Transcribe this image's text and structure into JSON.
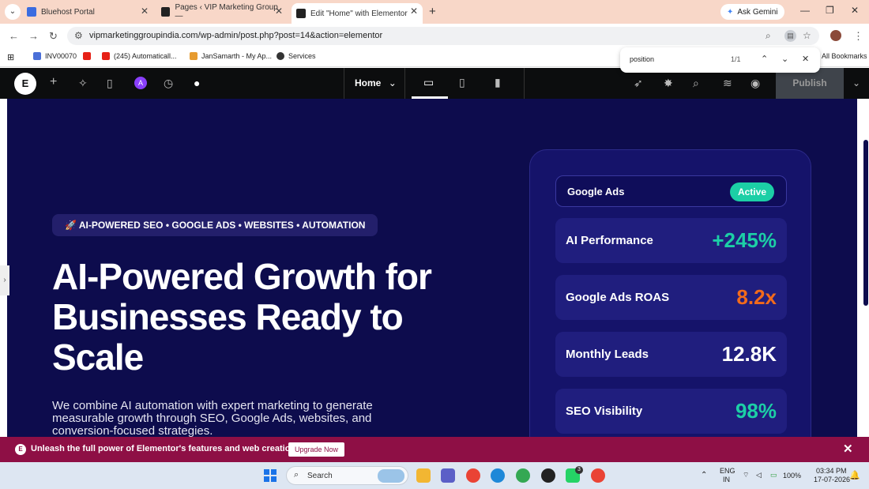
{
  "browser": {
    "tabs": [
      {
        "title": "Bluehost Portal",
        "color": "#3b6ce0"
      },
      {
        "title": "Pages ‹ VIP Marketing Group —",
        "color": "#222222"
      },
      {
        "title": "Edit \"Home\" with Elementor",
        "color": "#222222"
      }
    ],
    "ask_gemini": "Ask Gemini",
    "url": "vipmarketinggroupindia.com/wp-admin/post.php?post=14&action=elementor",
    "bookmarks": [
      {
        "label": "INV00070",
        "color": "#4a6fd8"
      },
      {
        "label": "",
        "color": "#e62117"
      },
      {
        "label": "(245) Automaticall...",
        "color": "#e62117"
      },
      {
        "label": "JanSamarth - My Ap...",
        "color": "#e69b2f"
      },
      {
        "label": "Services",
        "color": "#333333"
      }
    ],
    "all_bookmarks": "All Bookmarks",
    "find": {
      "query": "position",
      "count": "1/1"
    }
  },
  "editor": {
    "page_name": "Home",
    "publish_label": "Publish",
    "logo_letter": "E",
    "ai_letter": "A"
  },
  "hero": {
    "pill": "🚀 AI-POWERED SEO • GOOGLE ADS • WEBSITES • AUTOMATION",
    "title": "AI-Powered Growth for Businesses Ready to Scale",
    "subtitle": "We combine AI automation with expert marketing to generate measurable growth through SEO, Google Ads, websites, and conversion-focused strategies."
  },
  "stats_card": {
    "header_label": "Google Ads",
    "header_badge": "Active",
    "badge_color": "#1ccfa6",
    "stats": [
      {
        "label": "AI Performance",
        "value": "+245%",
        "color": "#1ccfa6"
      },
      {
        "label": "Google Ads ROAS",
        "value": "8.2x",
        "color": "#f26a1b"
      },
      {
        "label": "Monthly Leads",
        "value": "12.8K",
        "color": "#ffffff"
      },
      {
        "label": "SEO Visibility",
        "value": "98%",
        "color": "#1ccfa6"
      }
    ]
  },
  "promo": {
    "text": "Unleash the full power of Elementor's features and web creation tools.",
    "button": "Upgrade Now"
  },
  "taskbar": {
    "search_placeholder": "Search",
    "whatsapp_badge": "3",
    "lang_top": "ENG",
    "lang_bottom": "IN",
    "battery": "100%",
    "time": "03:34 PM",
    "date": "17-07-2026"
  }
}
